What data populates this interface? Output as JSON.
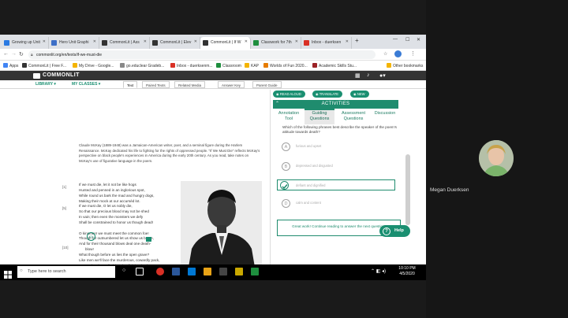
{
  "browser": {
    "tabs": [
      {
        "label": "Growing up Unit",
        "color": "#2a7ae2"
      },
      {
        "label": "Hero Unit Graphi",
        "color": "#3d6fc7"
      },
      {
        "label": "CommonLit | Ass",
        "color": "#333333"
      },
      {
        "label": "CommonLit | Elev",
        "color": "#333333"
      },
      {
        "label": "CommonLit | If W",
        "color": "#333333"
      },
      {
        "label": "Classwork for 7th",
        "color": "#1e8e3e"
      },
      {
        "label": "Inbox - duerksen",
        "color": "#d93025"
      }
    ],
    "url": "commonlit.org/en/texts/if-we-must-die",
    "bookmarks": [
      {
        "label": "Apps",
        "color": "#4285f4"
      },
      {
        "label": "CommonLit | Free F...",
        "color": "#333333"
      },
      {
        "label": "My Drive - Google...",
        "color": "#f4b400"
      },
      {
        "label": "go.educlear Gradeb...",
        "color": "#888888"
      },
      {
        "label": "Inbox - duerksenm...",
        "color": "#d93025"
      },
      {
        "label": "Classroom",
        "color": "#1e8e3e"
      },
      {
        "label": "KAP",
        "color": "#f4b400"
      },
      {
        "label": "Worlds of Fun 2020...",
        "color": "#e67c00"
      },
      {
        "label": "Academic Skills Stu...",
        "color": "#9b2226"
      }
    ],
    "other_bookmarks": "Other bookmarks"
  },
  "commonlit": {
    "logo": "COMMONLIT",
    "library": "LIBRARY",
    "my_classes": "MY CLASSES",
    "tabs": [
      "Text",
      "Paired Texts",
      "Related Media",
      "Answer Key",
      "Parent Guide"
    ],
    "intro": "Claude McKay (1889-1948) was a Jamaican-American writer, poet, and a seminal figure during the Harlem Renaissance. McKay dedicated his life to fighting for the rights of oppressed people. \"If We Must Die\" reflects McKay's perspective on black people's experiences in America during the early 20th century. As you read, take notes on McKay's use of figurative language in the poem.",
    "line_numbers": [
      "[1]",
      "[5]",
      "[10]"
    ],
    "poem_lines": [
      "If we must die, let it not be like hogs",
      "Hunted and penned in an inglorious spot,",
      "While round us bark the mad and hungry dogs,",
      "Making their mock at our accursèd lot.",
      "If we must die, O let us nobly die,",
      "So that our precious blood may not be shed",
      "In vain; then even the monsters we defy",
      "Shall be constrained to honor us though dead!",
      "",
      "O kinsmen!   we must meet the common foe!",
      "Though far outnumbered let us show us brave,",
      "And for their thousand blows deal one death-",
      "blow!",
      "What though before us lies the open grave?",
      "Like men we'll face the murderous, cowardly pack,",
      "Pressed to the wall, dying, but fighting back!"
    ],
    "buttons": {
      "read_aloud": "READ ALOUD",
      "translate": "TRANSLATE",
      "new": "NEW"
    },
    "activities_title": "ACTIVITIES",
    "activity_tabs": [
      {
        "line1": "Annotation",
        "line2": "Tool"
      },
      {
        "line1": "Guiding",
        "line2": "Questions"
      },
      {
        "line1": "Assessment",
        "line2": "Questions"
      },
      {
        "line1": "Discussion",
        "line2": ""
      }
    ],
    "question": "Which of the following phrases best describe the speaker of the poem's attitude towards death?",
    "options": [
      {
        "letter": "A",
        "text": "furious and upset"
      },
      {
        "letter": "B",
        "text": "depressed and disgusted"
      },
      {
        "letter": "C",
        "text": "defiant and dignified"
      },
      {
        "letter": "D",
        "text": "calm and content"
      }
    ],
    "feedback": "Great work! Continue reading to answer the next question.",
    "help": "Help"
  },
  "taskbar": {
    "search_placeholder": "Type here to search",
    "time": "10:10 PM",
    "date": "4/5/2020"
  },
  "meeting": {
    "participant_name": "Megan Duerksen"
  },
  "colors": {
    "brand": "#1a8f71",
    "header": "#333333"
  }
}
